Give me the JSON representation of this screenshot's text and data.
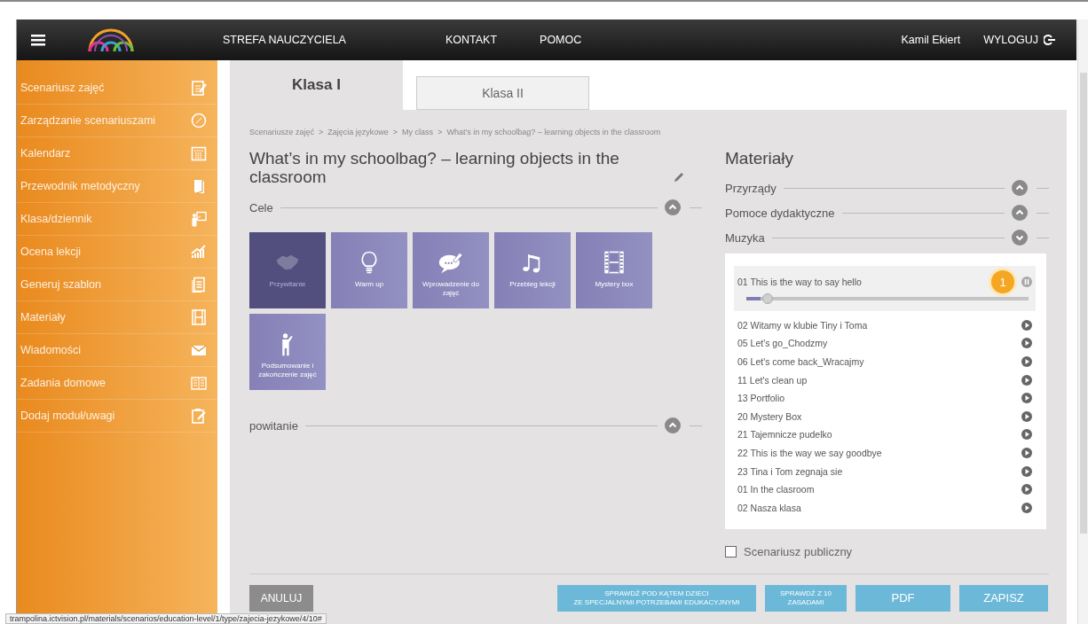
{
  "header": {
    "nav": [
      "STREFA NAUCZYCIELA",
      "KONTAKT",
      "POMOC"
    ],
    "user": "Kamil Ekiert",
    "logout": "WYLOGUJ"
  },
  "sidebar": {
    "items": [
      {
        "label": "Scenariusz zajęć"
      },
      {
        "label": "Zarządzanie scenariuszami"
      },
      {
        "label": "Kalendarz"
      },
      {
        "label": "Przewodnik metodyczny"
      },
      {
        "label": "Klasa/dziennik"
      },
      {
        "label": "Ocena lekcji"
      },
      {
        "label": "Generuj szablon"
      },
      {
        "label": "Materiały"
      },
      {
        "label": "Wiadomości"
      },
      {
        "label": "Zadania domowe"
      },
      {
        "label": "Dodaj moduł/uwagi"
      }
    ]
  },
  "tabs": [
    {
      "label": "Klasa I",
      "selected": true
    },
    {
      "label": "Klasa II",
      "selected": false
    }
  ],
  "breadcrumb": [
    "Scenariusze zajęć",
    "Zajęcia językowe",
    "My class",
    "What’s in my schoolbag? – learning objects in the classroom"
  ],
  "breadcrumb_separator": ">",
  "title": "What’s in my schoolbag? – learning objects in the classroom",
  "sections": [
    {
      "label": "Cele",
      "tiles": [
        {
          "label": "Przywitanie",
          "selected": true
        },
        {
          "label": "Warm up",
          "selected": false
        },
        {
          "label": "Wprowadzenie do zajęć",
          "selected": false
        },
        {
          "label": "Przebieg lekcji",
          "selected": false
        },
        {
          "label": "Mystery box",
          "selected": false
        },
        {
          "label": "Podsumowanie i zakończenie zajęć",
          "selected": false
        }
      ]
    },
    {
      "label": "powitanie"
    }
  ],
  "materials": {
    "title": "Materiały",
    "groups": [
      {
        "label": "Przyrządy",
        "expanded": false
      },
      {
        "label": "Pomoce dydaktyczne",
        "expanded": false
      },
      {
        "label": "Muzyka",
        "expanded": true
      }
    ],
    "tracks": [
      {
        "name": "01 This is the way to say hello",
        "playing": true,
        "level": 0.05,
        "badge": "1"
      },
      {
        "name": "02 Witamy w klubie Tiny i Toma",
        "playing": false
      },
      {
        "name": "05 Let's go_Chodzmy",
        "playing": false
      },
      {
        "name": "06 Let's come back_Wracajmy",
        "playing": false
      },
      {
        "name": "11 Let's clean up",
        "playing": false
      },
      {
        "name": "13 Portfolio",
        "playing": false
      },
      {
        "name": "20 Mystery Box",
        "playing": false
      },
      {
        "name": "21 Tajemnicze pudelko",
        "playing": false
      },
      {
        "name": "22 This is the way we say goodbye",
        "playing": false
      },
      {
        "name": "23 Tina i Tom zegnaja sie",
        "playing": false
      },
      {
        "name": "01 In the clasroom",
        "playing": false
      },
      {
        "name": "02 Nasza klasa",
        "playing": false
      }
    ]
  },
  "public_checkbox": {
    "label": "Scenariusz publiczny",
    "checked": false
  },
  "buttons": [
    {
      "label": "ANULUJ",
      "kind": "secondary"
    },
    {
      "label": "SPRAWDŹ POD KĄTEM DZIECI\nZE SPECJALNYMI POTRZEBAMI EDUKACYJNYMI",
      "kind": "primary"
    },
    {
      "label": "SPRAWDŹ Z 10\nZASADAMI",
      "kind": "primary"
    },
    {
      "label": "PDF",
      "kind": "primary"
    },
    {
      "label": "ZAPISZ",
      "kind": "primary"
    }
  ],
  "status_url": "trampolina.ictvision.pl/materials/scenarios/education-level/1/type/zajecia-jezykowe/4/10#"
}
